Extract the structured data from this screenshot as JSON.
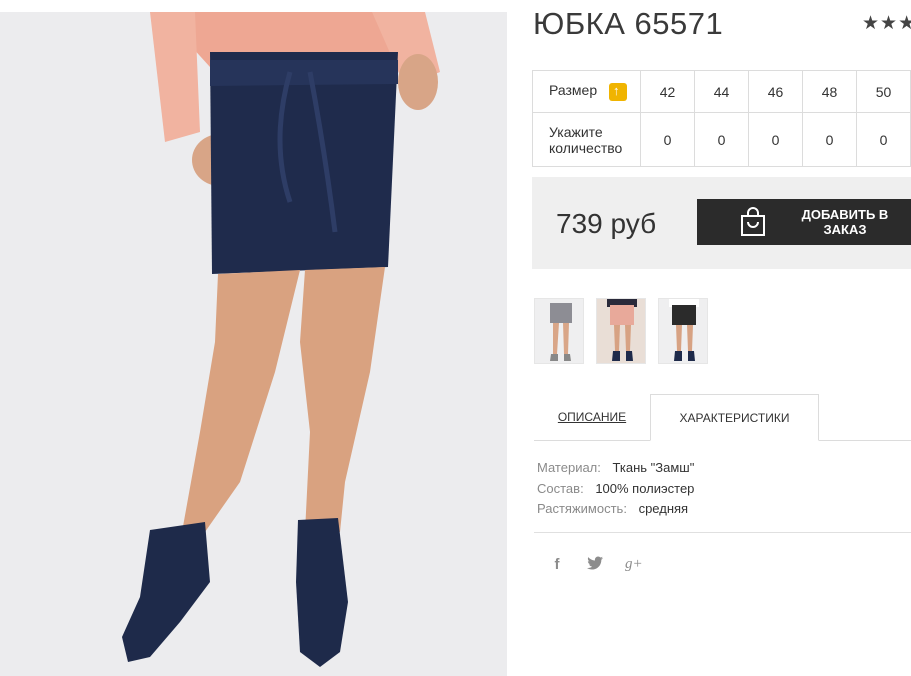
{
  "product": {
    "title": "ЮБКА 65571",
    "rating_display": "★★★★★"
  },
  "sizes": {
    "size_label": "Размер",
    "quantity_label_line1": "Укажите",
    "quantity_label_line2": "количество",
    "columns": [
      "42",
      "44",
      "46",
      "48",
      "50"
    ],
    "quantities": [
      "0",
      "0",
      "0",
      "0",
      "0"
    ]
  },
  "buy": {
    "price": "739 руб",
    "add_button_label": "ДОБАВИТЬ В ЗАКАЗ"
  },
  "tabs": {
    "description": "ОПИСАНИЕ",
    "characteristics": "ХАРАКТЕРИСТИКИ"
  },
  "specs": [
    {
      "key": "Материал:",
      "value": "Ткань \"Замш\""
    },
    {
      "key": "Состав:",
      "value": "100% полиэстер"
    },
    {
      "key": "Растяжимость:",
      "value": "средняя"
    }
  ],
  "social": {
    "facebook": "f",
    "twitter": "t",
    "googleplus": "g+"
  },
  "icons": [
    "size-chart-icon",
    "shopping-bag-icon",
    "facebook-icon",
    "twitter-icon",
    "google-plus-icon"
  ],
  "colors": {
    "button": "#2b2b2b",
    "accent": "#f0b400",
    "skirt": "#1e2a4a"
  }
}
